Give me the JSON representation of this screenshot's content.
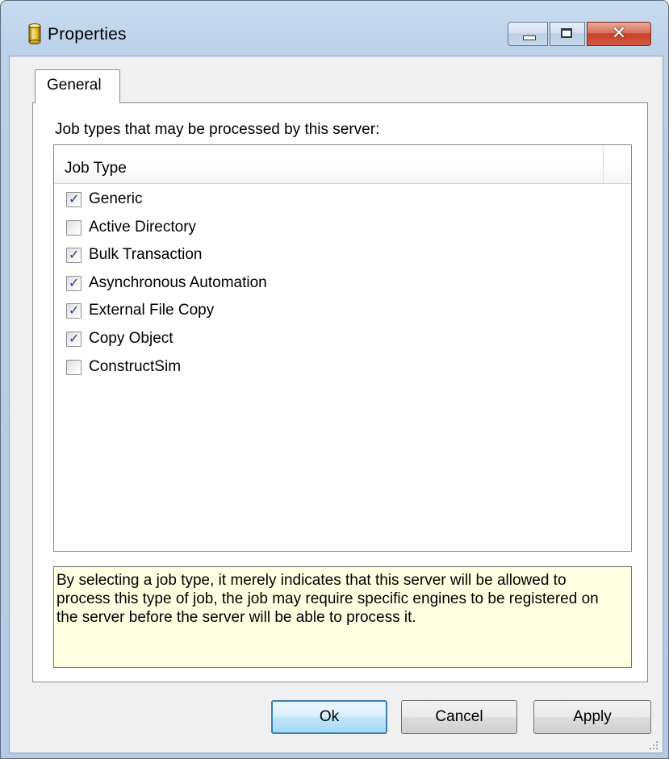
{
  "window": {
    "title": "Properties",
    "icon": "database-cylinder-icon",
    "controls": {
      "minimize_icon": "minimize-icon",
      "maximize_icon": "maximize-icon",
      "close_glyph": "✕"
    }
  },
  "tabs": [
    {
      "label": "General",
      "selected": true
    }
  ],
  "general": {
    "group_label": "Job types that may be processed by this server:",
    "list": {
      "column_header": "Job Type",
      "items": [
        {
          "label": "Generic",
          "checked": true
        },
        {
          "label": "Active Directory",
          "checked": false
        },
        {
          "label": "Bulk Transaction",
          "checked": true
        },
        {
          "label": "Asynchronous Automation",
          "checked": true
        },
        {
          "label": "External File Copy",
          "checked": true
        },
        {
          "label": "Copy Object",
          "checked": true
        },
        {
          "label": "ConstructSim",
          "checked": false
        }
      ]
    },
    "note": "By selecting a job type, it merely indicates that this server will be allowed to process this type of job, the job may require specific engines to be registered on the server before the server will be able to process it."
  },
  "buttons": {
    "ok": "Ok",
    "cancel": "Cancel",
    "apply": "Apply"
  },
  "colors": {
    "note_background": "#ffffe1",
    "check_mark": "#213f8e",
    "close_button": "#c7412a",
    "frame": "#b9cfe8"
  }
}
